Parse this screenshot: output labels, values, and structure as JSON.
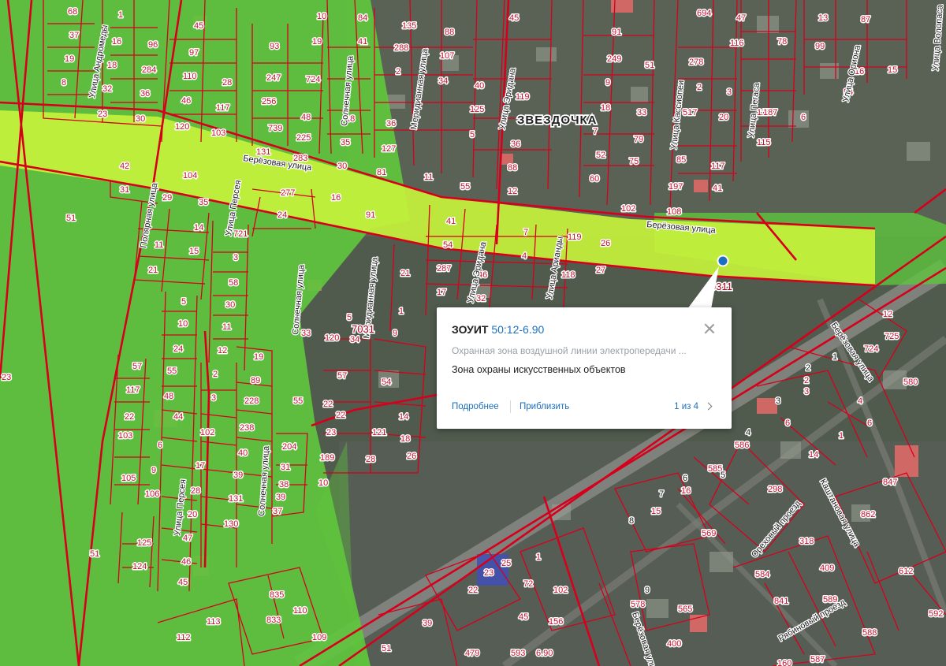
{
  "map": {
    "place_name": "ЗВЕЗДОЧКА",
    "streets": {
      "andromeda": "Улица Андромеды",
      "polar": "Полярная улица",
      "berezovaya": "Берёзовая улица",
      "perseya": "Улица Персея",
      "solnechnaya": "Солнечная улица",
      "meridiannaya": "Меридианная улица",
      "eridana": "Улица Эридана",
      "kassiopei": "Улица Кассиопеи",
      "pegasa": "Улица Пегаса",
      "oriona": "Улица Ориона",
      "volopasa": "Улица Волопаса",
      "ariadny": "Улица Арианды",
      "orekhovy": "Ореховый проезд",
      "kashtanovaya": "Каштановая улица",
      "ryabinovy": "Рябиновый проезд"
    },
    "zone_codes": [
      "0311",
      "7031"
    ],
    "marker_color": "#1c6fbf",
    "zone_fill_green": "#5fc63d",
    "zone_fill_yellow": "#c7f23c",
    "parcel_line_color": "#d6001c"
  },
  "popup": {
    "title_prefix": "ЗОУИТ",
    "cad_number": "50:12-6.90",
    "subtitle": "Охранная зона воздушной линии электропередачи ...",
    "description": "Зона охраны искусственных объектов",
    "link_more": "Подробнее",
    "link_zoom": "Приблизить",
    "pager": "1 из 4",
    "close_icon": "close-icon",
    "next_icon": "chevron-right-icon"
  }
}
